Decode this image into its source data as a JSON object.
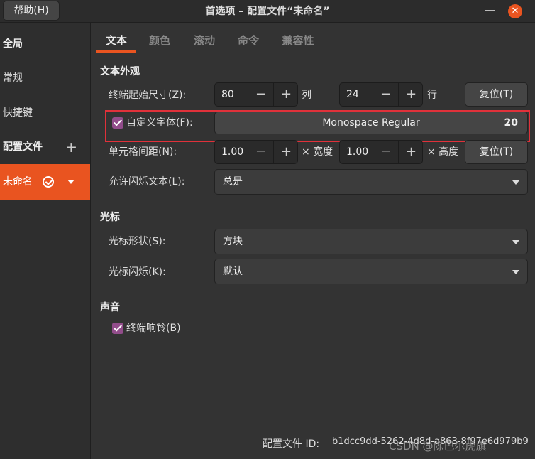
{
  "titlebar": {
    "help_label": "帮助(H)",
    "title": "首选项 – 配置文件“未命名”",
    "close_glyph": "✕"
  },
  "sidebar": {
    "global": "全局",
    "general": "常规",
    "shortcuts": "快捷键",
    "profiles": "配置文件",
    "add_glyph": "+",
    "profile_name": "未命名"
  },
  "tabs": [
    "文本",
    "颜色",
    "滚动",
    "命令",
    "兼容性"
  ],
  "text_appearance": {
    "title": "文本外观",
    "initial_size_label": "终端起始尺寸(Z):",
    "cols": "80",
    "cols_unit": "列",
    "rows": "24",
    "rows_unit": "行",
    "reset_label": "复位(T)",
    "custom_font_label": "自定义字体(F):",
    "font_name": "Monospace Regular",
    "font_size": "20",
    "cell_spacing_label": "单元格间距(N):",
    "width_value": "1.00",
    "width_unit": "× 宽度",
    "height_value": "1.00",
    "height_unit": "× 高度",
    "blink_label": "允许闪烁文本(L):",
    "blink_value": "总是"
  },
  "cursor": {
    "title": "光标",
    "shape_label": "光标形状(S):",
    "shape_value": "方块",
    "blink_label": "光标闪烁(K):",
    "blink_value": "默认"
  },
  "sound": {
    "title": "声音",
    "bell_label": "终端响铃(B)"
  },
  "footer": {
    "id_label": "配置文件 ID:",
    "id_value": "b1dcc9dd-5262-4d8d-a863-8f97e6d979b9",
    "watermark": "CSDN @陈巴尔虎旗"
  },
  "colors": {
    "accent": "#e95420",
    "checkbox": "#924d8b",
    "highlight": "#e0313a"
  },
  "spin_minus": "−",
  "spin_plus": "+"
}
